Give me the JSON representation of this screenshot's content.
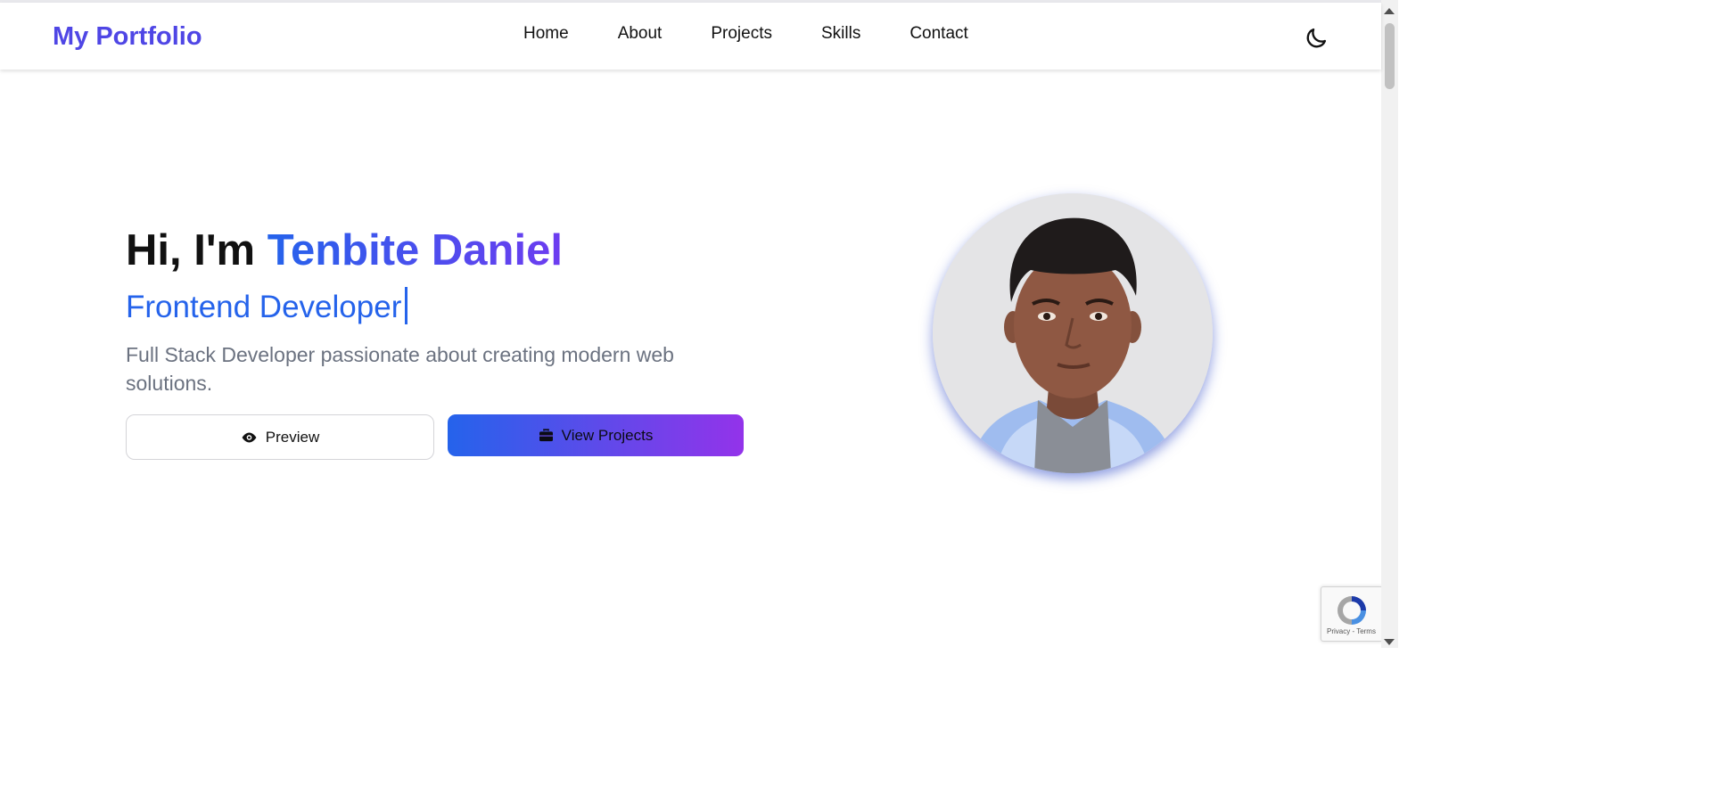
{
  "header": {
    "brand": "My Portfolio",
    "nav": [
      "Home",
      "About",
      "Projects",
      "Skills",
      "Contact"
    ],
    "theme_toggle_icon": "moon-icon"
  },
  "hero": {
    "greeting": "Hi, I'm ",
    "name": "Tenbite Daniel",
    "role": "Frontend Developer",
    "description": "Full Stack Developer passionate about creating modern web solutions.",
    "preview_button": {
      "label": "Preview",
      "icon": "eye-icon"
    },
    "projects_button": {
      "label": "View Projects",
      "icon": "briefcase-icon"
    },
    "avatar_icon": "profile-photo"
  },
  "recaptcha": {
    "text": "Privacy - Terms",
    "icon": "recaptcha-icon"
  },
  "colors": {
    "brand": "#4f46e5",
    "accent_blue": "#2563eb",
    "accent_purple": "#9333ea"
  }
}
